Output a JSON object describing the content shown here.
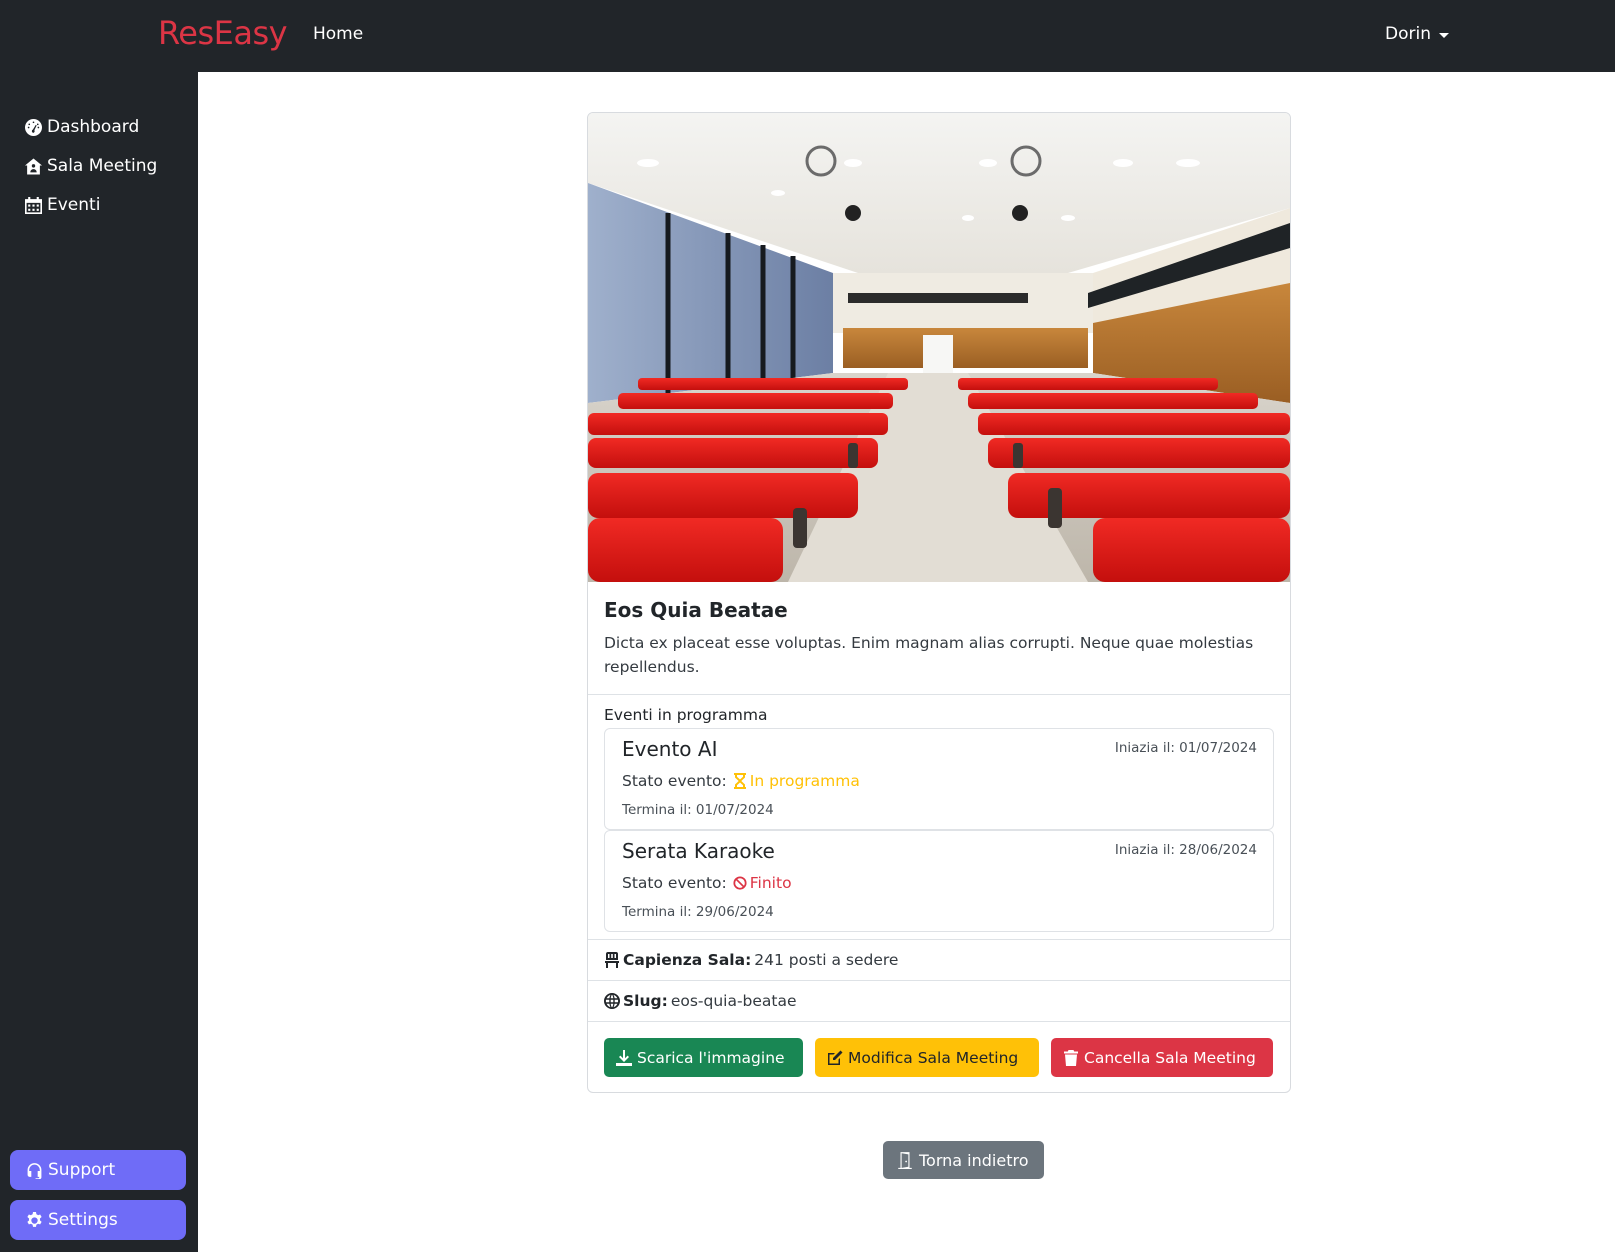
{
  "navbar": {
    "brand": "ResEasy",
    "home_label": "Home",
    "user_name": "Dorin"
  },
  "sidebar": {
    "items": [
      {
        "label": "Dashboard",
        "icon": "gauge-icon"
      },
      {
        "label": "Sala Meeting",
        "icon": "house-user-icon"
      },
      {
        "label": "Eventi",
        "icon": "calendar-icon"
      }
    ],
    "support_label": "Support",
    "settings_label": "Settings"
  },
  "room": {
    "image_alt": "Conference hall with red seats",
    "title": "Eos Quia Beatae",
    "description": "Dicta ex placeat esse voluptas. Enim magnam alias corrupti. Neque quae molestias repellendus.",
    "events_heading": "Eventi in programma",
    "events": [
      {
        "name": "Evento AI",
        "start": "Iniazia il: 01/07/2024",
        "status_label": "Stato evento:",
        "status": "In programma",
        "status_icon": "hourglass-icon",
        "status_color": "#ffc107",
        "end": "Termina il: 01/07/2024"
      },
      {
        "name": "Serata Karaoke",
        "start": "Iniazia il: 28/06/2024",
        "status_label": "Stato evento:",
        "status": "Finito",
        "status_icon": "ban-icon",
        "status_color": "#dc3545",
        "end": "Termina il: 29/06/2024"
      }
    ],
    "capacity_label": "Capienza Sala:",
    "capacity_value": "241 posti a sedere",
    "slug_label": "Slug:",
    "slug_value": "eos-quia-beatae"
  },
  "actions": {
    "download_label": "Scarica l'immagine",
    "edit_label": "Modifica Sala Meeting",
    "delete_label": "Cancella Sala Meeting",
    "back_label": "Torna indietro"
  },
  "colors": {
    "brand": "#dc3545",
    "sidebar_bg": "#212529",
    "sidebar_button": "#6f6cf7",
    "success": "#198754",
    "warning": "#ffc107",
    "danger": "#dc3545",
    "secondary": "#6c757d"
  }
}
